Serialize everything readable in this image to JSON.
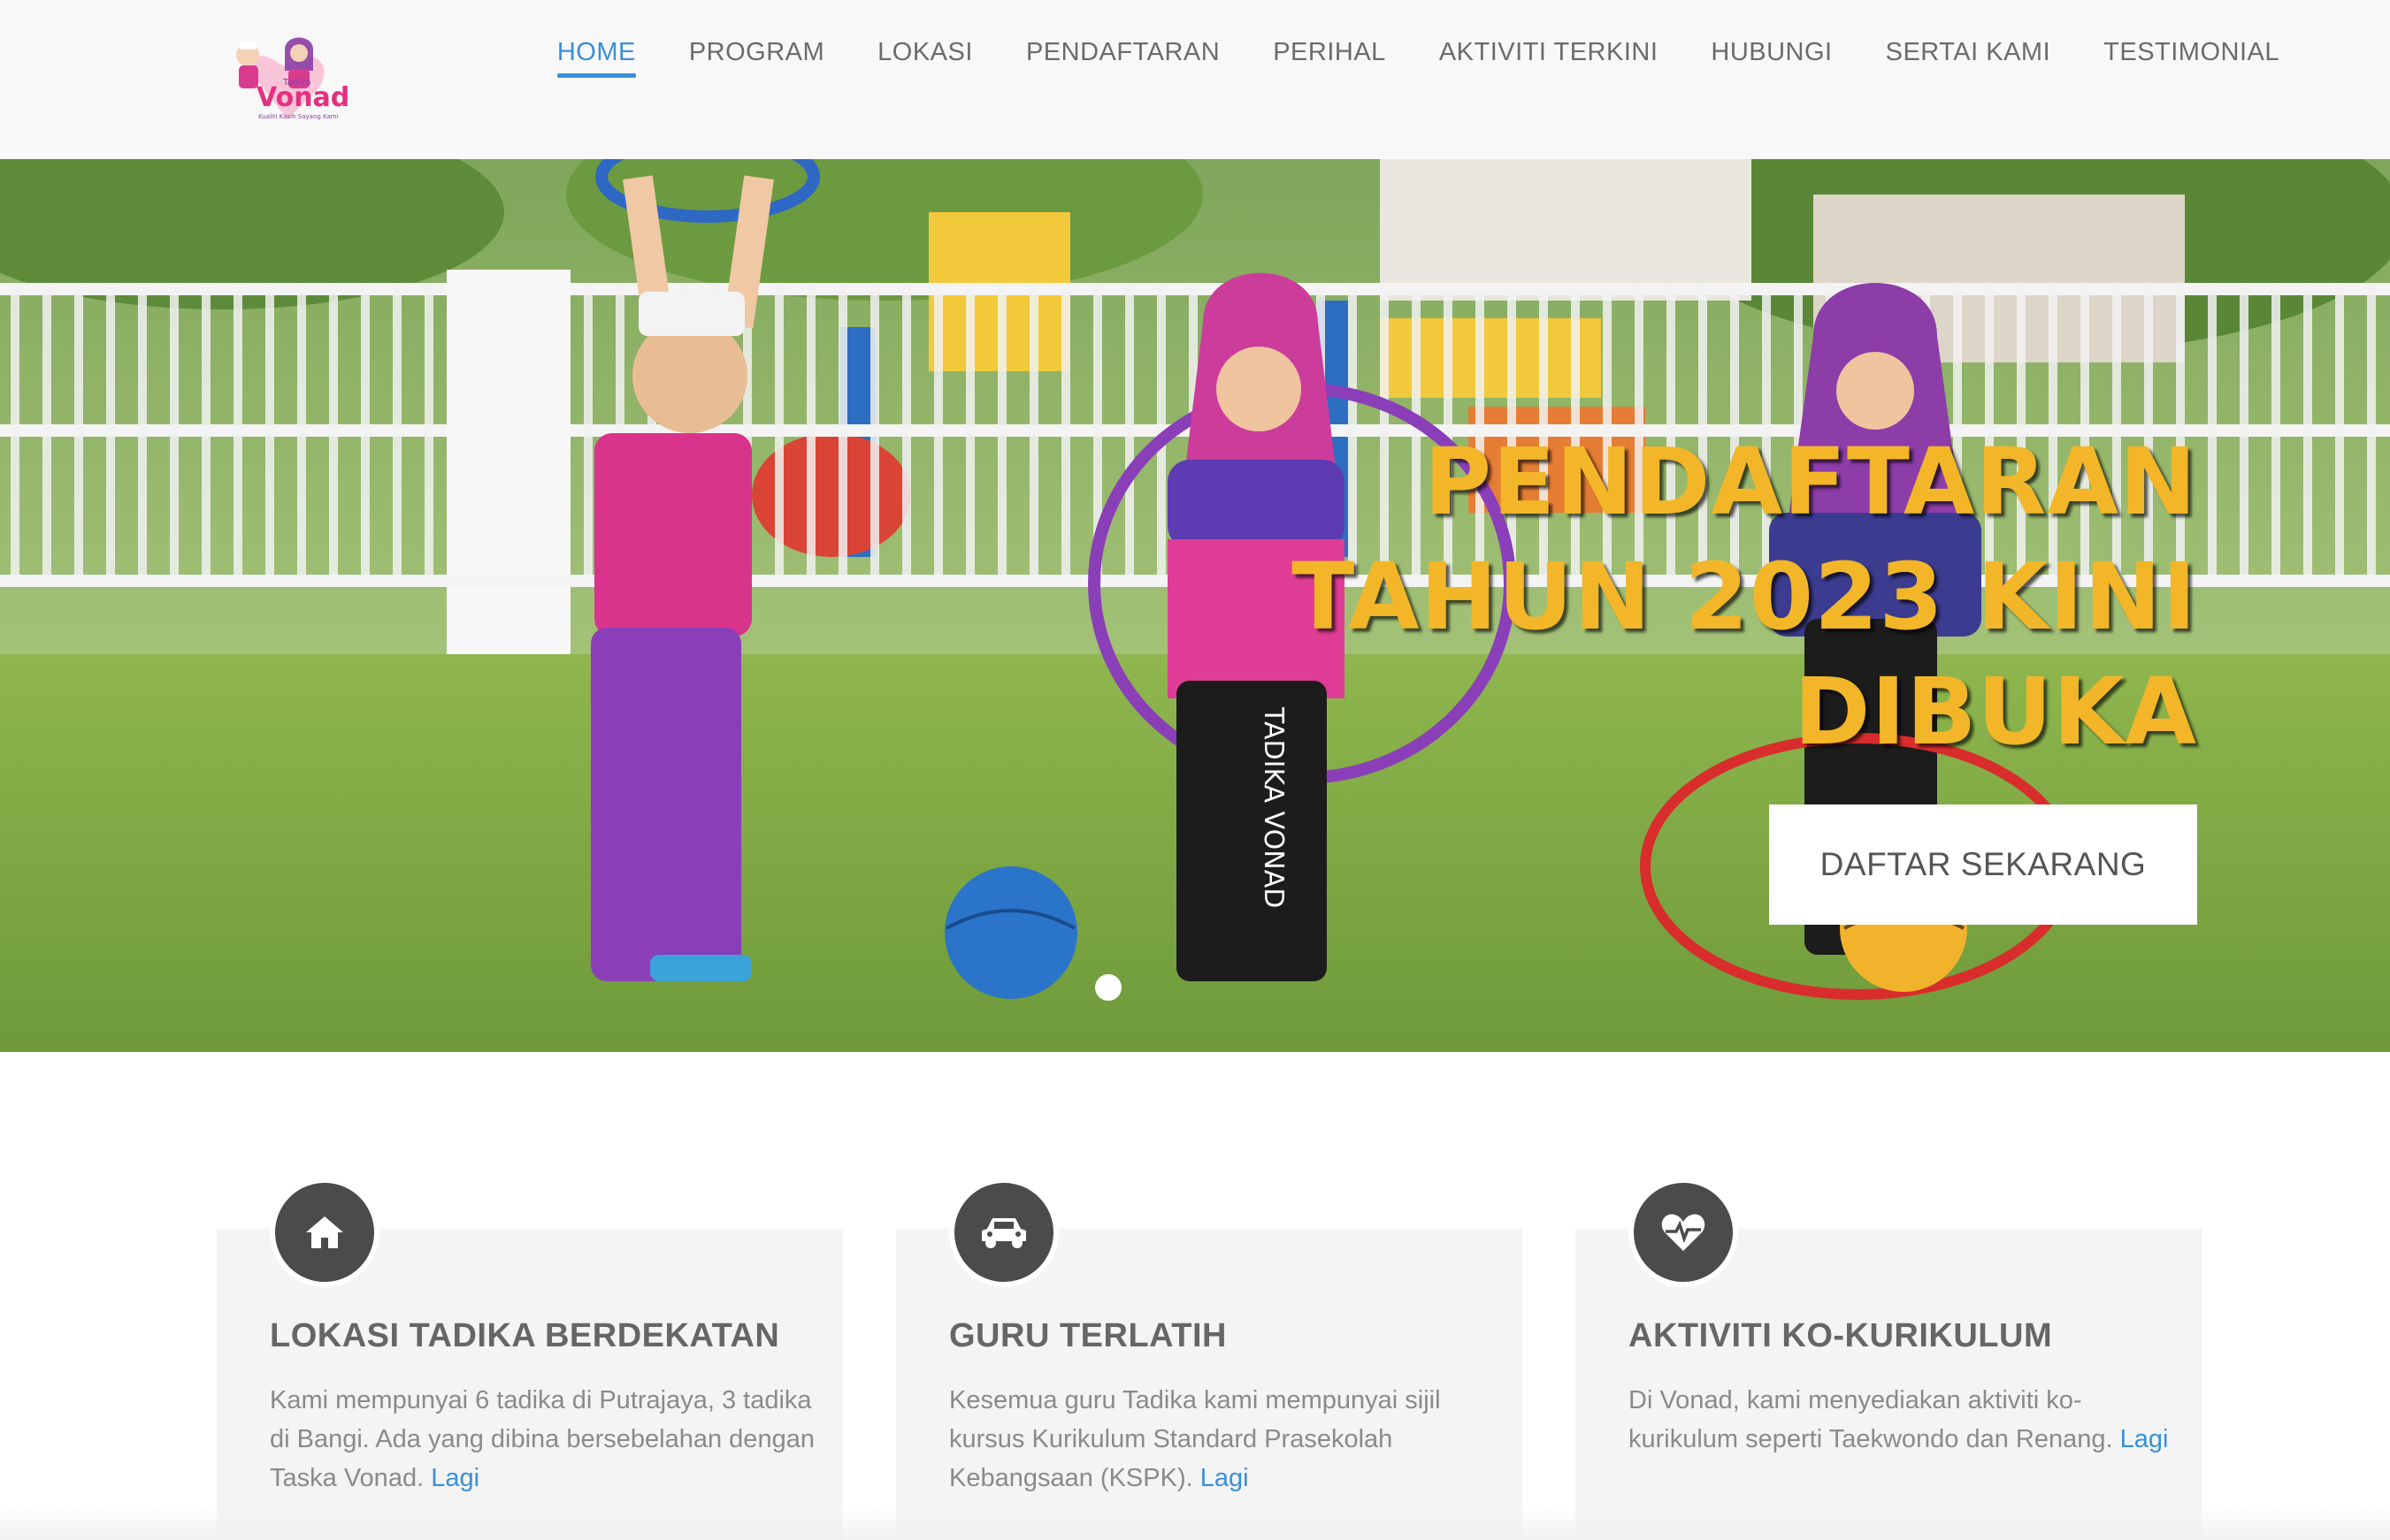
{
  "brand": {
    "logo_word": "Vonad",
    "logo_small": "Tadika",
    "logo_tagline": "Kualiti Kasih Sayang Kami"
  },
  "nav": {
    "items": [
      {
        "label": "HOME",
        "active": true
      },
      {
        "label": "PROGRAM",
        "active": false
      },
      {
        "label": "LOKASI",
        "active": false
      },
      {
        "label": "PENDAFTARAN",
        "active": false
      },
      {
        "label": "PERIHAL",
        "active": false
      },
      {
        "label": "AKTIVITI TERKINI",
        "active": false
      },
      {
        "label": "HUBUNGI",
        "active": false
      },
      {
        "label": "SERTAI KAMI",
        "active": false
      },
      {
        "label": "TESTIMONIAL",
        "active": false
      }
    ]
  },
  "hero": {
    "title_line1": "PENDAFTARAN",
    "title_line2": "TAHUN 2023 KINI",
    "title_line3": "DIBUKA",
    "button_label": "DAFTAR SEKARANG",
    "pants_text": "TADIKA VONAD"
  },
  "features": [
    {
      "icon": "home-icon",
      "title": "LOKASI TADIKA BERDEKATAN",
      "text": "Kami mempunyai 6 tadika di Putrajaya, 3 tadika di Bangi. Ada yang dibina bersebelahan dengan Taska Vonad.",
      "link": "Lagi"
    },
    {
      "icon": "car-icon",
      "title": "GURU TERLATIH",
      "text": "Kesemua guru Tadika kami mempunyai sijil kursus Kurikulum Standard Prasekolah Kebangsaan (KSPK).",
      "link": "Lagi"
    },
    {
      "icon": "heartbeat-icon",
      "title": "AKTIVITI KO-KURIKULUM",
      "text": "Di Vonad, kami menyediakan aktiviti ko-kurikulum seperti Taekwondo dan Renang.",
      "link": "Lagi"
    }
  ],
  "colors": {
    "accent": "#3a8fd9",
    "hero_title": "#f2b628",
    "icon_circle": "#4b4b4b",
    "card_bg": "#f4f4f4"
  }
}
